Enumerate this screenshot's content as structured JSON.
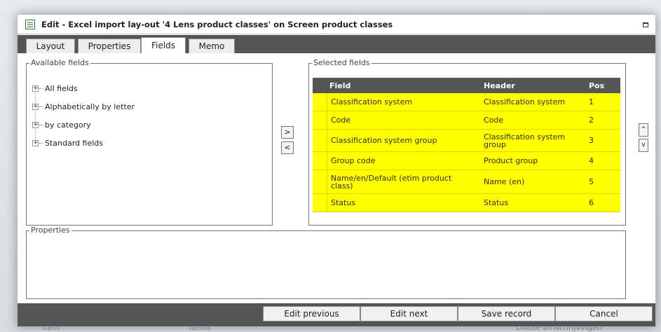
{
  "window": {
    "title": "Edit - Excel import lay-out '4 Lens product classes' on Screen product classes"
  },
  "tabs": [
    {
      "label": "Layout"
    },
    {
      "label": "Properties"
    },
    {
      "label": "Fields"
    },
    {
      "label": "Memo"
    }
  ],
  "active_tab": "Fields",
  "available_fields": {
    "legend": "Available fields",
    "items": [
      {
        "label": "All fields"
      },
      {
        "label": "Alphabetically by letter"
      },
      {
        "label": "by category"
      },
      {
        "label": "Standard fields"
      }
    ]
  },
  "move_buttons": {
    "add_label": ">",
    "remove_label": "<"
  },
  "selected_fields": {
    "legend": "Selected fields",
    "columns": {
      "field": "Field",
      "header": "Header",
      "pos": "Pos"
    },
    "rows": [
      {
        "field": "Classification system",
        "header": "Classification system",
        "pos": "1"
      },
      {
        "field": "Code",
        "header": "Code",
        "pos": "2"
      },
      {
        "field": "Classification system group",
        "header": "Classification system group",
        "pos": "3"
      },
      {
        "field": "Group code",
        "header": "Product group",
        "pos": "4"
      },
      {
        "field": "Name/en/Default (etim product class)",
        "header": "Name (en)",
        "pos": "5"
      },
      {
        "field": "Status",
        "header": "Status",
        "pos": "6"
      }
    ],
    "row_highlight_color": "#ffff00",
    "header_bg_color": "#555555"
  },
  "order_buttons": {
    "up_label": "^",
    "down_label": "v"
  },
  "properties": {
    "legend": "Properties"
  },
  "actions": {
    "edit_previous": "Edit previous",
    "edit_next": "Edit next",
    "save_record": "Save record",
    "cancel": "Cancel"
  },
  "background_row": {
    "col1": "Item",
    "col2": "Items",
    "col3": "Duitse omschrijvingen"
  }
}
